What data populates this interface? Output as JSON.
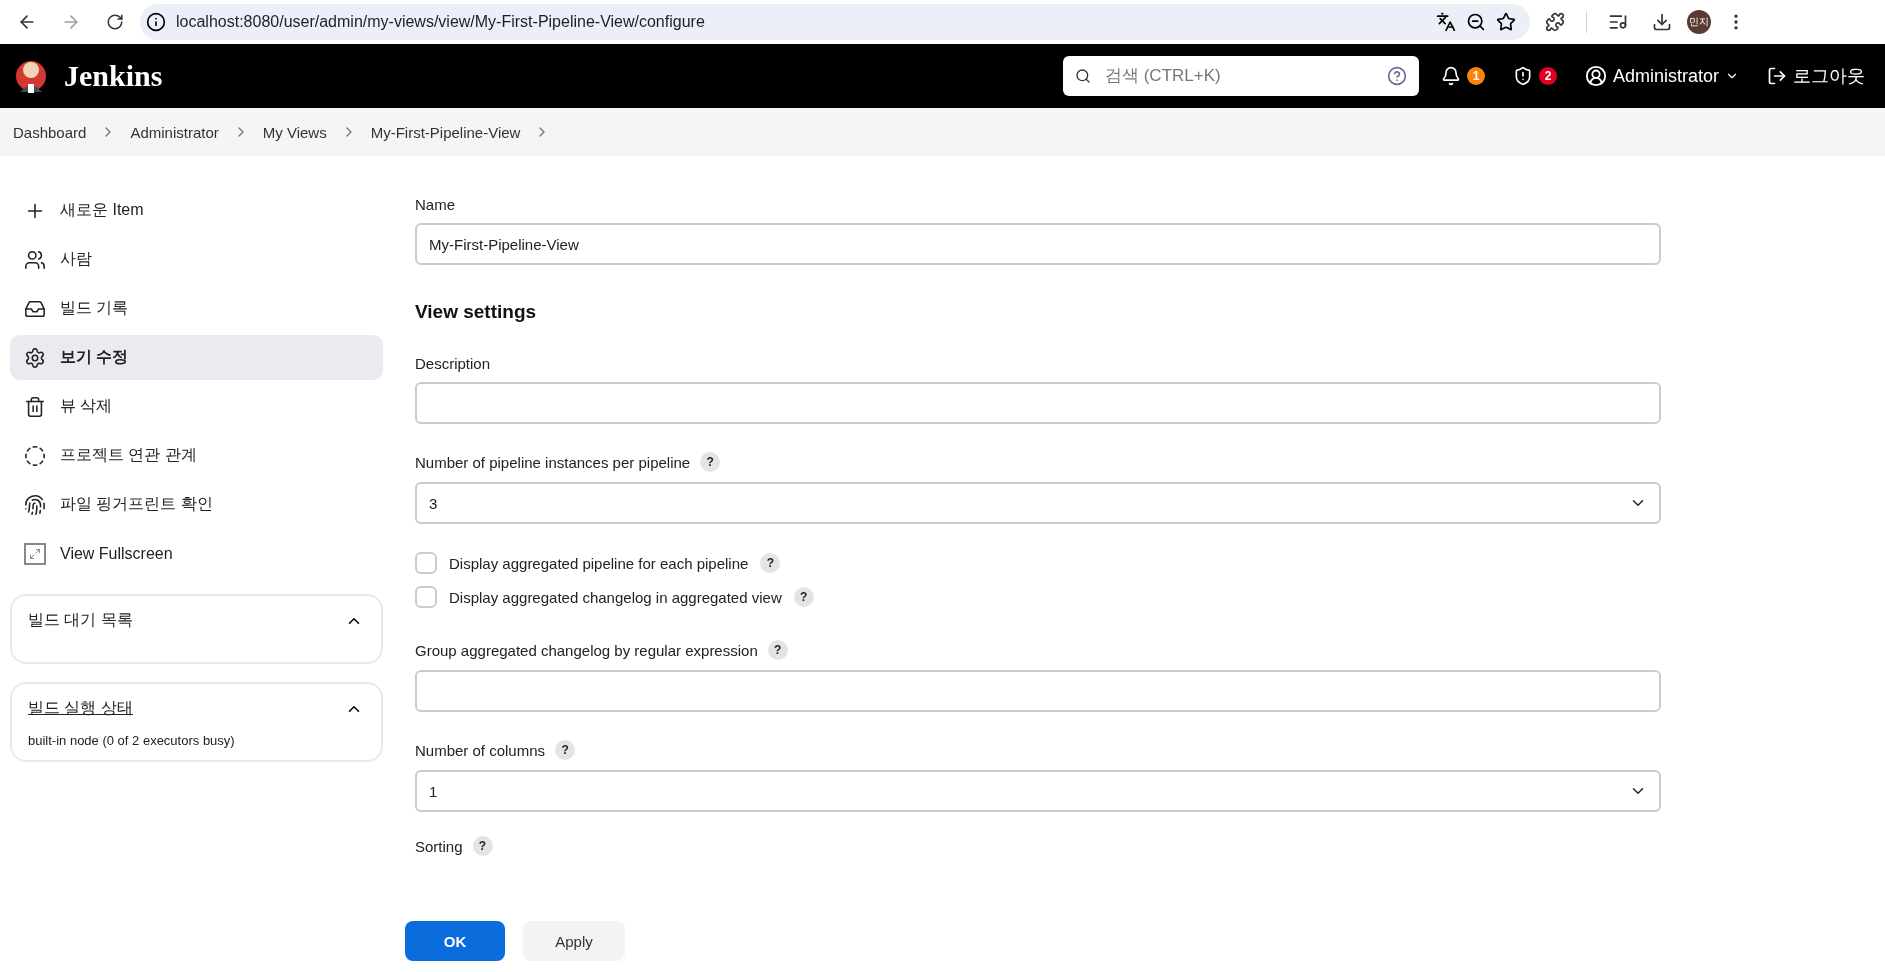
{
  "browser": {
    "url": "localhost:8080/user/admin/my-views/view/My-First-Pipeline-View/configure",
    "profile": "민지"
  },
  "header": {
    "brand": "Jenkins",
    "search_placeholder": "검색 (CTRL+K)",
    "notifications": "1",
    "security": "2",
    "user": "Administrator",
    "logout": "로그아웃"
  },
  "breadcrumbs": [
    "Dashboard",
    "Administrator",
    "My Views",
    "My-First-Pipeline-View"
  ],
  "sidebar": {
    "items": [
      {
        "label": "새로운 Item",
        "kind": "plus",
        "selected": false
      },
      {
        "label": "사람",
        "kind": "people",
        "selected": false
      },
      {
        "label": "빌드 기록",
        "kind": "inbox",
        "selected": false
      },
      {
        "label": "보기 수정",
        "kind": "gear",
        "selected": true
      },
      {
        "label": "뷰 삭제",
        "kind": "trash",
        "selected": false
      },
      {
        "label": "프로젝트 연관 관계",
        "kind": "relation",
        "selected": false
      },
      {
        "label": "파일 핑거프린트 확인",
        "kind": "fingerprint",
        "selected": false
      },
      {
        "label": "View Fullscreen",
        "kind": "fullscreen",
        "selected": false
      }
    ],
    "panels": [
      {
        "title": "빌드 대기 목록",
        "link": false,
        "expanded": true
      },
      {
        "title": "빌드 실행 상태",
        "link": true,
        "expanded": true,
        "body": "built-in node (0 of 2 executors busy)"
      }
    ]
  },
  "form": {
    "fields": [
      {
        "kind": "text",
        "label": "Name",
        "value": "My-First-Pipeline-View"
      },
      {
        "kind": "heading",
        "label": "View settings"
      },
      {
        "kind": "text",
        "label": "Description"
      },
      {
        "kind": "select",
        "label": "Number of pipeline instances per pipeline",
        "help": "?",
        "value": "3"
      },
      {
        "kind": "checkbox",
        "label": "Display aggregated pipeline for each pipeline",
        "help": "?",
        "checked": false
      },
      {
        "kind": "checkbox",
        "label": "Display aggregated changelog in aggregated view",
        "help": "?",
        "checked": false
      },
      {
        "kind": "text",
        "label": "Group aggregated changelog by regular expression",
        "help": "?"
      },
      {
        "kind": "select",
        "label": "Number of columns",
        "help": "?",
        "value": "1"
      },
      {
        "kind": "label",
        "label": "Sorting",
        "help": "?"
      }
    ]
  },
  "buttons": [
    {
      "label": "OK",
      "kind": "primary"
    },
    {
      "label": "Apply",
      "kind": "secondary"
    }
  ]
}
